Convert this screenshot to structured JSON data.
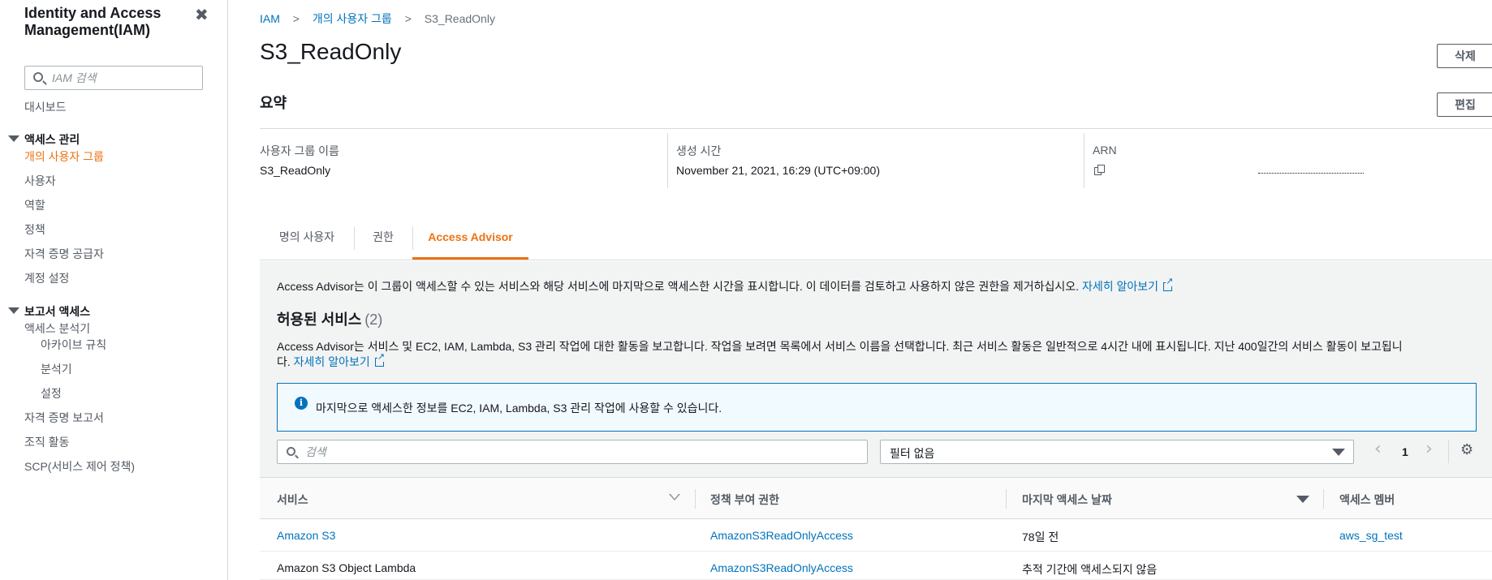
{
  "sidebar": {
    "title": "Identity and Access Management(IAM)",
    "search_placeholder": "IAM 검색",
    "dashboard": "대시보드",
    "access_mgmt": {
      "heading": "액세스 관리",
      "items": [
        "개의 사용자 그룹",
        "사용자",
        "역할",
        "정책",
        "자격 증명 공급자",
        "계정 설정"
      ]
    },
    "report_access": {
      "heading": "보고서 액세스",
      "analyzer": "액세스 분석기",
      "analyzer_items": [
        "아카이브 규칙",
        "분석기",
        "설정"
      ],
      "items": [
        "자격 증명 보고서",
        "조직 활동",
        "SCP(서비스 제어 정책)"
      ]
    }
  },
  "breadcrumb": {
    "items": [
      "IAM",
      "개의 사용자 그룹",
      "S3_ReadOnly"
    ]
  },
  "page": {
    "title": "S3_ReadOnly",
    "delete_label": "삭제",
    "summary_title": "요약",
    "edit_label": "편집"
  },
  "summary": {
    "group_name_label": "사용자 그룹 이름",
    "group_name_value": "S3_ReadOnly",
    "created_label": "생성 시간",
    "created_value": "November 21, 2021, 16:29 (UTC+09:00)",
    "arn_label": "ARN"
  },
  "tabs": [
    "명의 사용자",
    "권한",
    "Access Advisor"
  ],
  "advisor": {
    "intro": "Access Advisor는 이 그룹이 액세스할 수 있는 서비스와 해당 서비스에 마지막으로 액세스한 시간을 표시합니다. 이 데이터를 검토하고 사용하지 않은 권한을 제거하십시오.",
    "learn_more": "자세히 알아보기",
    "services_title": "허용된 서비스",
    "services_count": "(2)",
    "desc_line1": "Access Advisor는 서비스 및 EC2, IAM, Lambda, S3 관리 작업에 대한 활동을 보고합니다. 작업을 보려면 목록에서 서비스 이름을 선택합니다. 최근 서비스 활동은 일반적으로 4시간 내에 표시됩니다. 지난 400일간의 서비스 활동이 보고됩니",
    "desc_line2": "다.",
    "info_text": "마지막으로 액세스한 정보를 EC2, IAM, Lambda, S3 관리 작업에 사용할 수 있습니다.",
    "search_placeholder": "검색",
    "filter_value": "필터 없음",
    "page_number": "1"
  },
  "table": {
    "headers": [
      "서비스",
      "정책 부여 권한",
      "마지막 액세스 날짜",
      "액세스 멤버"
    ],
    "rows": [
      {
        "service": "Amazon S3",
        "policy": "AmazonS3ReadOnlyAccess",
        "last_access": "78일 전",
        "member": "aws_sg_test"
      },
      {
        "service": "Amazon S3 Object Lambda",
        "policy": "AmazonS3ReadOnlyAccess",
        "last_access": "추적 기간에 액세스되지 않음",
        "member": ""
      }
    ]
  }
}
